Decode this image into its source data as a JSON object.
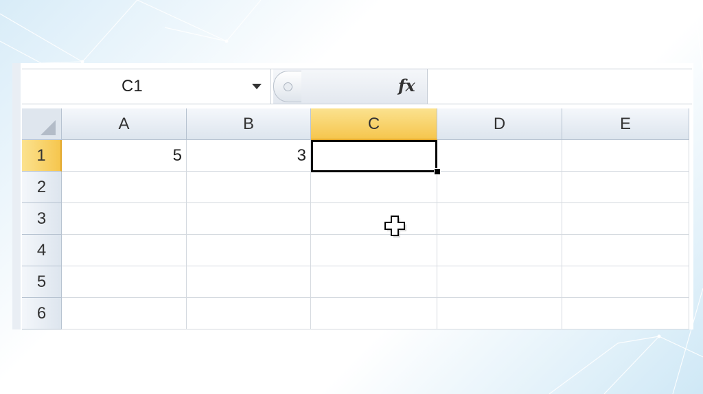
{
  "formula_bar": {
    "name_box": "C1",
    "fx_label": "fx",
    "formula": ""
  },
  "columns": [
    "A",
    "B",
    "C",
    "D",
    "E"
  ],
  "selected_column": "C",
  "rows": [
    {
      "num": "1",
      "cells": [
        "5",
        "3",
        "",
        "",
        ""
      ]
    },
    {
      "num": "2",
      "cells": [
        "",
        "",
        "",
        "",
        ""
      ]
    },
    {
      "num": "3",
      "cells": [
        "",
        "",
        "",
        "",
        ""
      ]
    },
    {
      "num": "4",
      "cells": [
        "",
        "",
        "",
        "",
        ""
      ]
    },
    {
      "num": "5",
      "cells": [
        "",
        "",
        "",
        "",
        ""
      ]
    },
    {
      "num": "6",
      "cells": [
        "",
        "",
        "",
        "",
        ""
      ]
    }
  ],
  "selected_row": "1",
  "active_cell": "C1",
  "colors": {
    "selected_header": "#f6c64e",
    "grid_line": "#d4d9df",
    "header_bg": "#dde5ee"
  },
  "icons": {
    "select_all": "select-all-triangle",
    "cursor": "cross-cursor-icon",
    "dropdown": "chevron-down-icon",
    "fx": "function-icon"
  }
}
